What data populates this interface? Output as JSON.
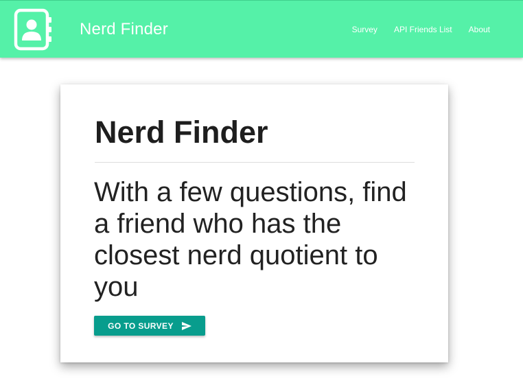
{
  "navbar": {
    "logo_icon": "contact-book-icon",
    "brand": "Nerd Finder",
    "links": [
      {
        "label": "Survey"
      },
      {
        "label": "API Friends List"
      },
      {
        "label": "About"
      }
    ],
    "background_color": "#55f1a8"
  },
  "hero": {
    "title": "Nerd Finder",
    "lead": "With a few questions, find a friend who has the closest nerd quotient to you",
    "button": {
      "label": "GO TO SURVEY",
      "icon": "send-icon",
      "color": "#089d8d"
    }
  }
}
